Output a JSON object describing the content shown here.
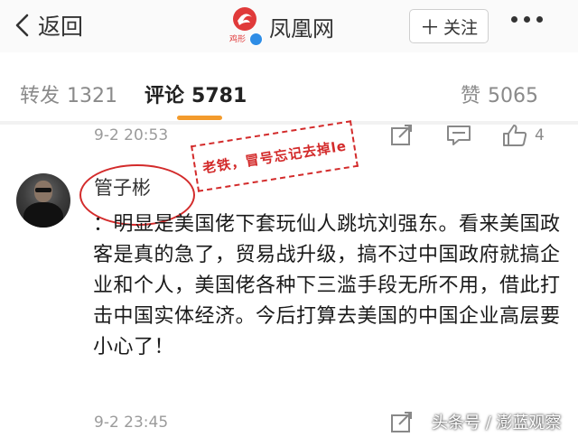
{
  "header": {
    "back_label": "返回",
    "brand_name": "凤凰网",
    "brand_logo_text": "鸡形",
    "follow_label": "关注"
  },
  "tabs": [
    {
      "label": "转发",
      "count": "1321"
    },
    {
      "label": "评论",
      "count": "5781"
    },
    {
      "label": "赞",
      "count": "5065"
    }
  ],
  "active_tab": "评论",
  "accent_color": "#f39b2c",
  "prev_comment": {
    "time": "9-2 20:53",
    "like_count": "4"
  },
  "stamp_text": "老铁，冒号忘记去掉le",
  "comment": {
    "username": "管子彬",
    "text": "：明显是美国佬下套玩仙人跳坑刘强东。看来美国政客是真的急了，贸易战升级，搞不过中国政府就搞企业和个人，美国佬各种下三滥手段无所不用，借此打击中国实体经济。今后打算去美国的中国企业高层要小心了！",
    "time": "9-2 23:45"
  },
  "watermark": "头条号 / 澎蓝观察",
  "icons": [
    "chevron-left-icon",
    "phoenix-logo-icon",
    "verified-badge-icon",
    "more-icon",
    "repost-icon",
    "comment-icon",
    "like-icon"
  ]
}
